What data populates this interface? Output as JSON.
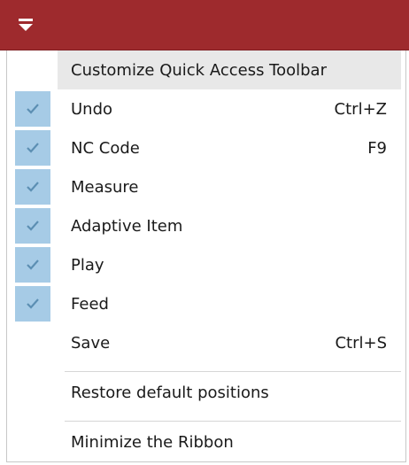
{
  "title_bar": {
    "color": "#9e2a2d",
    "qat_icon": "customize-dropdown-icon"
  },
  "menu": {
    "header": "Customize Quick Access Toolbar",
    "check_color": "#a6cbe6",
    "items": [
      {
        "label": "Undo",
        "shortcut": "Ctrl+Z",
        "checked": true
      },
      {
        "label": "NC Code",
        "shortcut": "F9",
        "checked": true
      },
      {
        "label": "Measure",
        "shortcut": "",
        "checked": true
      },
      {
        "label": "Adaptive Item",
        "shortcut": "",
        "checked": true
      },
      {
        "label": "Play",
        "shortcut": "",
        "checked": true
      },
      {
        "label": "Feed",
        "shortcut": "",
        "checked": true
      },
      {
        "label": "Save",
        "shortcut": "Ctrl+S",
        "checked": false
      }
    ],
    "restore_label": "Restore default positions",
    "minimize_label": "Minimize the Ribbon"
  }
}
